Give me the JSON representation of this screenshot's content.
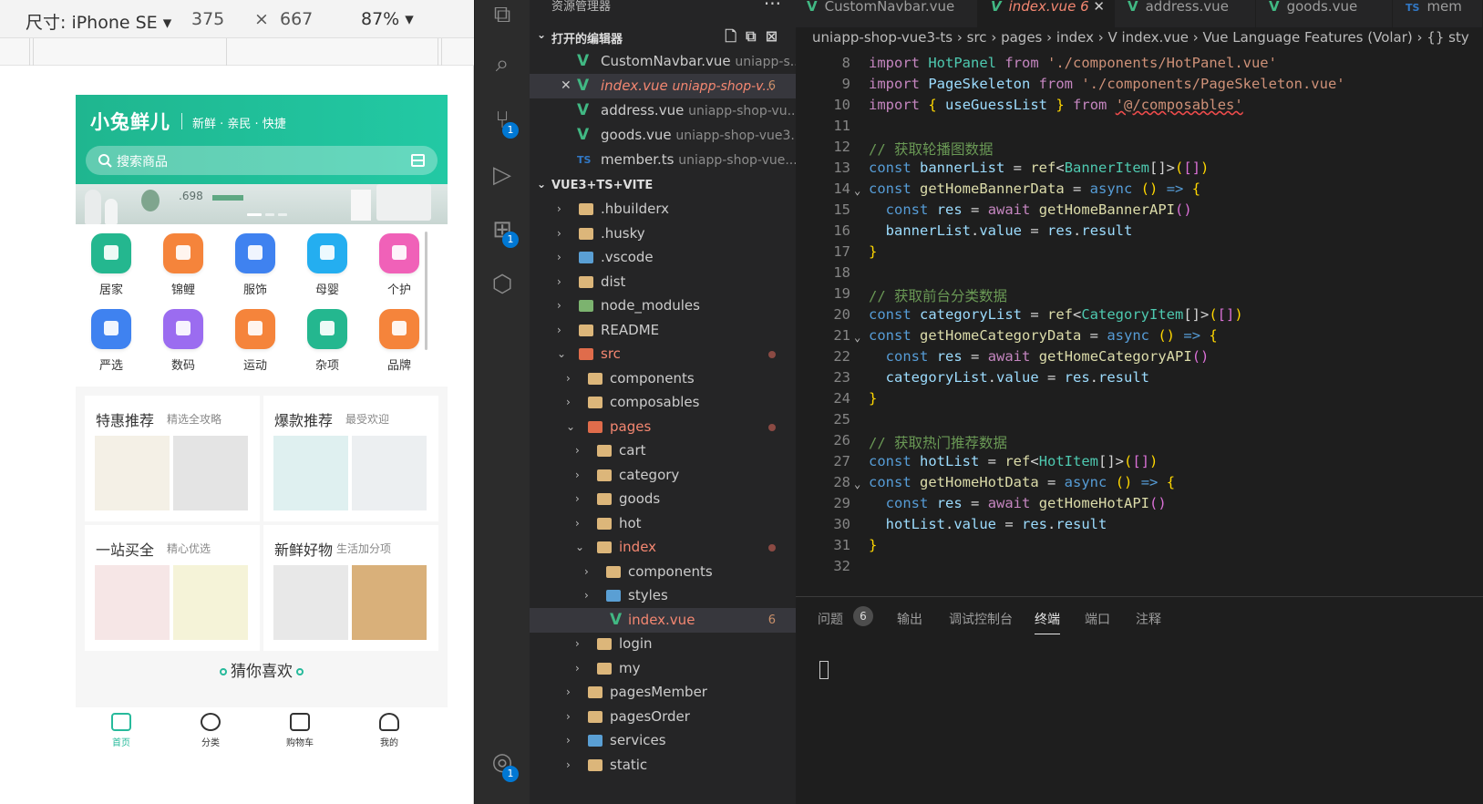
{
  "device_toolbar": {
    "size_label": "尺寸: iPhone SE",
    "width": "375",
    "times": "×",
    "height": "667",
    "zoom": "87%"
  },
  "phone": {
    "logo": "小兔鲜儿",
    "slogan": "新鲜 · 亲民 · 快捷",
    "search_placeholder": "搜索商品",
    "banner_price": ".698",
    "categories": [
      {
        "label": "居家",
        "color": "#24b78f"
      },
      {
        "label": "锦鲤",
        "color": "#f5843b"
      },
      {
        "label": "服饰",
        "color": "#3f82f0"
      },
      {
        "label": "母婴",
        "color": "#24aef0"
      },
      {
        "label": "个护",
        "color": "#f061b8"
      },
      {
        "label": "严选",
        "color": "#3f82f0"
      },
      {
        "label": "数码",
        "color": "#9b6cf0"
      },
      {
        "label": "运动",
        "color": "#f5843b"
      },
      {
        "label": "杂项",
        "color": "#24b78f"
      },
      {
        "label": "品牌",
        "color": "#f5843b"
      }
    ],
    "promos": [
      {
        "title": "特惠推荐",
        "sub": "精选全攻略"
      },
      {
        "title": "爆款推荐",
        "sub": "最受欢迎"
      },
      {
        "title": "一站买全",
        "sub": "精心优选"
      },
      {
        "title": "新鲜好物",
        "sub": "生活加分项"
      }
    ],
    "guess_title": "猜你喜欢",
    "tabs": [
      {
        "label": "首页"
      },
      {
        "label": "分类"
      },
      {
        "label": "购物车"
      },
      {
        "label": "我的"
      }
    ]
  },
  "explorer": {
    "title": "资源管理器",
    "open_editors_label": "打开的编辑器",
    "project_label": "VUE3+TS+VITE",
    "open_editors": [
      {
        "name": "CustomNavbar.vue",
        "path": "uniapp-s...",
        "type": "vue"
      },
      {
        "name": "index.vue",
        "path": "uniapp-shop-v...",
        "type": "vue",
        "count": "6"
      },
      {
        "name": "address.vue",
        "path": "uniapp-shop-vu...",
        "type": "vue"
      },
      {
        "name": "goods.vue",
        "path": "uniapp-shop-vue3...",
        "type": "vue"
      },
      {
        "name": "member.ts",
        "path": "uniapp-shop-vue...",
        "type": "ts"
      }
    ],
    "tree": [
      {
        "name": ".hbuilderx",
        "depth": 0
      },
      {
        "name": ".husky",
        "depth": 0
      },
      {
        "name": ".vscode",
        "depth": 0
      },
      {
        "name": "dist",
        "depth": 0
      },
      {
        "name": "node_modules",
        "depth": 0
      },
      {
        "name": "README",
        "depth": 0
      },
      {
        "name": "src",
        "depth": 0
      },
      {
        "name": "components",
        "depth": 1
      },
      {
        "name": "composables",
        "depth": 1
      },
      {
        "name": "pages",
        "depth": 1
      },
      {
        "name": "cart",
        "depth": 2
      },
      {
        "name": "category",
        "depth": 2
      },
      {
        "name": "goods",
        "depth": 2
      },
      {
        "name": "hot",
        "depth": 2
      },
      {
        "name": "index",
        "depth": 2
      },
      {
        "name": "components",
        "depth": 3
      },
      {
        "name": "styles",
        "depth": 3
      },
      {
        "name": "index.vue",
        "depth": 3,
        "count": "6"
      },
      {
        "name": "login",
        "depth": 2
      },
      {
        "name": "my",
        "depth": 2
      },
      {
        "name": "pagesMember",
        "depth": 1
      },
      {
        "name": "pagesOrder",
        "depth": 1
      },
      {
        "name": "services",
        "depth": 1
      },
      {
        "name": "static",
        "depth": 1
      }
    ]
  },
  "editor": {
    "tabs": [
      {
        "label": "CustomNavbar.vue"
      },
      {
        "label": "index.vue",
        "count": "6"
      },
      {
        "label": "address.vue"
      },
      {
        "label": "goods.vue"
      },
      {
        "label": "mem"
      }
    ],
    "breadcrumb": "uniapp-shop-vue3-ts › src › pages › index › V index.vue › Vue Language Features (Volar) › {} sty",
    "line_numbers": [
      "8",
      "9",
      "10",
      "11",
      "12",
      "13",
      "14",
      "15",
      "16",
      "17",
      "18",
      "19",
      "20",
      "21",
      "22",
      "23",
      "24",
      "25",
      "26",
      "27",
      "28",
      "29",
      "30",
      "31",
      "32"
    ],
    "panel_tabs": [
      "问题",
      "输出",
      "调试控制台",
      "终端",
      "端口",
      "注释"
    ],
    "problems_count": "6"
  }
}
